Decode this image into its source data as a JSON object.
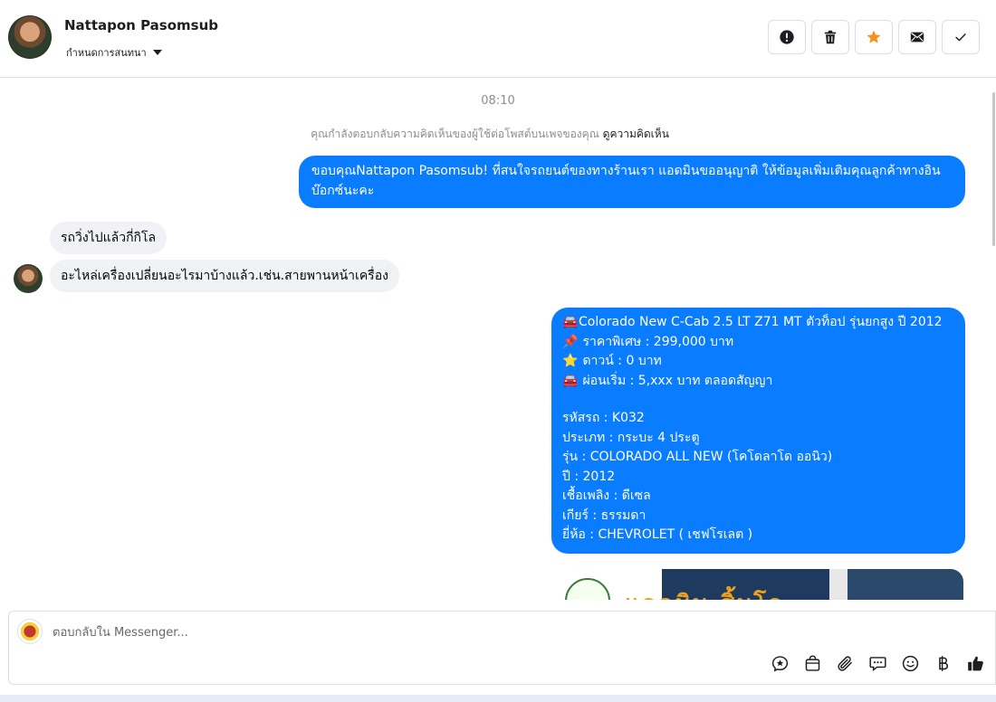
{
  "header": {
    "contact_name": "Nattapon Pasomsub",
    "assign_label": "กำหนดการสนทนา",
    "actions": [
      {
        "name": "mark-spam-button",
        "icon": "exclamation-circle-icon"
      },
      {
        "name": "delete-button",
        "icon": "trash-icon"
      },
      {
        "name": "star-button",
        "icon": "star-icon"
      },
      {
        "name": "mark-unread-button",
        "icon": "envelope-icon"
      },
      {
        "name": "mark-done-button",
        "icon": "check-icon"
      }
    ]
  },
  "conversation": {
    "timestamp": "08:10",
    "notice_text": "คุณกำลังตอบกลับความคิดเห็นของผู้ใช้ต่อโพสต์บนเพจของคุณ",
    "notice_link": "ดูความคิดเห็น",
    "messages": [
      {
        "direction": "outgoing",
        "text": "ขอบคุณNattapon Pasomsub! ที่สนใจรถยนต์ของทางร้านเรา แอดมินขออนุญาติ ให้ข้อมูลเพิ่มเติมคุณลูกค้าทางอินบ๊อกซ์นะคะ"
      },
      {
        "direction": "incoming",
        "text": "รถวิ่งไปแล้วกี่กิโล"
      },
      {
        "direction": "incoming",
        "text": "อะไหล่เครื่องเปลี่ยนอะไรมาบ้างแล้ว.เช่น.สายพานหน้าเครื่อง"
      }
    ],
    "car_listing": {
      "headline_emoji": "🚘",
      "headline": "Colorado New C-Cab 2.5 LT Z71 MT ตัวท็อป รุ่นยกสูง ปี 2012",
      "price_emoji": "📌",
      "price": "ราคาพิเศษ : 299,000 บาท",
      "down_emoji": "⭐",
      "down": "ดาวน์ : 0 บาท",
      "installment_emoji": "🚘",
      "installment": "ผ่อนเริ่ม : 5,xxx บาท ตลอดสัญญา",
      "code": "รหัสรถ : K032",
      "type": "ประเภท : กระบะ 4 ประตู",
      "model": "รุ่น : COLORADO ALL NEW (โคโดลาโด ออนิว)",
      "year": "ปี : 2012",
      "fuel": "เชื้อเพลิง : ดีเซล",
      "gear": "เกียร์ : ธรรมดา",
      "brand": "ยี่ห้อ : CHEVROLET ( เชฟโรเลต )"
    },
    "image_caption": "แอดมิน สิ้มโอ"
  },
  "composer": {
    "placeholder": "ตอบกลับใน Messenger...",
    "tools": [
      {
        "name": "saved-reply-button",
        "icon": "star-bubble-icon"
      },
      {
        "name": "shop-button",
        "icon": "shopping-bag-icon"
      },
      {
        "name": "attach-button",
        "icon": "paperclip-icon"
      },
      {
        "name": "quick-reply-button",
        "icon": "chat-bubbles-icon"
      },
      {
        "name": "emoji-button",
        "icon": "smiley-icon"
      },
      {
        "name": "payment-button",
        "icon": "baht-icon"
      },
      {
        "name": "like-button",
        "icon": "thumbs-up-icon"
      }
    ]
  },
  "colors": {
    "outgoing_bubble": "#0a7cff",
    "incoming_bubble": "#f0f2f5",
    "star_accent": "#f5921b"
  }
}
